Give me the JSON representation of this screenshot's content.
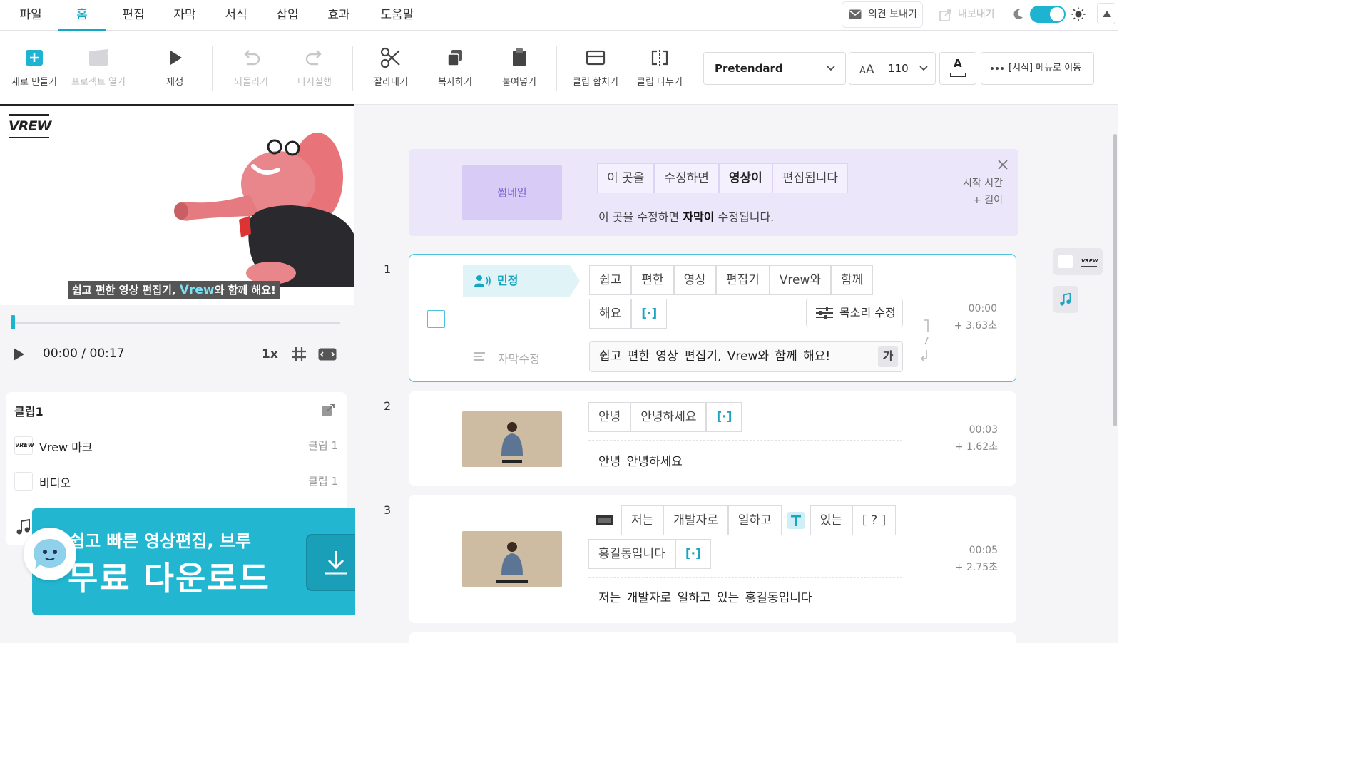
{
  "menu": {
    "items": [
      "파일",
      "홈",
      "편집",
      "자막",
      "서식",
      "삽입",
      "효과",
      "도움말"
    ],
    "active_index": 1,
    "feedback_label": "의견 보내기",
    "export_label": "내보내기"
  },
  "toolbar": {
    "new": "새로 만들기",
    "open": "프로젝트 열기",
    "play": "재생",
    "undo": "되돌리기",
    "redo": "다시실행",
    "cut": "잘라내기",
    "copy": "복사하기",
    "paste": "붙여넣기",
    "merge": "클립 합치기",
    "split": "클립 나누기",
    "font": "Pretendard",
    "font_size": "110",
    "color_glyph": "A",
    "more": "[서식] 메뉴로 이동"
  },
  "preview": {
    "logo": "VREW",
    "subtitle_pre": "쉽고 편한 영상 편집기, ",
    "subtitle_hl": "Vrew",
    "subtitle_post": "와 함께 해요!",
    "timecode": "00:00 / 00:17",
    "speed": "1x",
    "progress": 0
  },
  "clip_panel": {
    "title": "클립1",
    "rows": [
      {
        "name": "Vrew 마크",
        "ref": "클립 1"
      },
      {
        "name": "비디오",
        "ref": "클립 1"
      }
    ]
  },
  "ad": {
    "sub": "쉽고 빠른 영상편집, 브루",
    "main": "무료 다운로드"
  },
  "guide": {
    "thumb": "썸네일",
    "words": [
      "이 곳을",
      "수정하면",
      "영상이",
      "편집됩니다"
    ],
    "sub_pre": "이 곳을 수정하면 ",
    "sub_bold": "자막이",
    "sub_post": " 수정됩니다.",
    "time_label": "시작 시간",
    "length_label": "+ 길이"
  },
  "clips": [
    {
      "num": "1",
      "speaker": "민정",
      "words_row1": [
        "쉽고",
        "편한",
        "영상",
        "편집기",
        "Vrew와",
        "함께"
      ],
      "words_row2": [
        "해요",
        "[·]"
      ],
      "voice_btn": "목소리 수정",
      "subtitle_edit": "자막수정",
      "subtitle": "쉽고 편한 영상 편집기, Vrew와 함께 해요!",
      "ga": "가",
      "start": "00:00",
      "length": "+ 3.63초"
    },
    {
      "num": "2",
      "words_row1": [
        "안녕",
        "안녕하세요",
        "[·]"
      ],
      "subtitle": "안녕 안녕하세요",
      "start": "00:03",
      "length": "+ 1.62초"
    },
    {
      "num": "3",
      "words_row1": [
        "저는",
        "개발자로",
        "일하고",
        "있는",
        "[ ? ]"
      ],
      "words_row2": [
        "홍길동입니다",
        "[·]"
      ],
      "subtitle": "저는 개발자로 일하고 있는 홍길동입니다",
      "start": "00:05",
      "length": "+ 2.75초"
    }
  ],
  "colors": {
    "accent": "#14a8c5",
    "guide_bg": "#ece6fb",
    "ad_bg": "#23b6d0"
  }
}
